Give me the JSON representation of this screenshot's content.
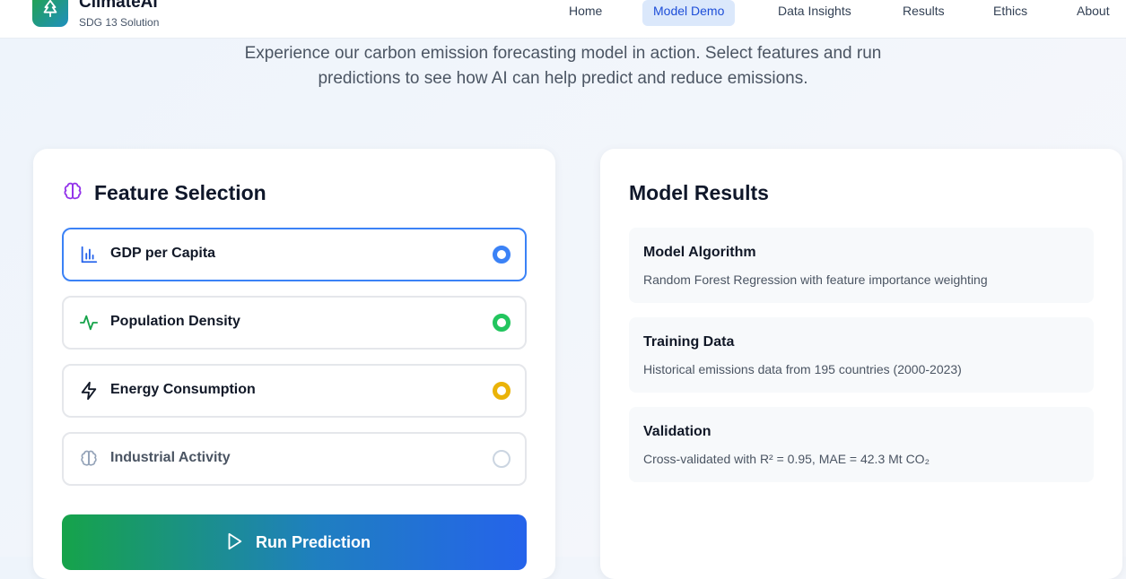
{
  "brand": {
    "name": "ClimateAI",
    "subtitle": "SDG 13 Solution"
  },
  "nav": {
    "items": [
      {
        "label": "Home"
      },
      {
        "label": "Model Demo",
        "active": true
      },
      {
        "label": "Data Insights"
      },
      {
        "label": "Results"
      },
      {
        "label": "Ethics"
      },
      {
        "label": "About"
      }
    ]
  },
  "hero": {
    "line1": "Experience our carbon emission forecasting model in action. Select features and run",
    "line2": "predictions to see how AI can help predict and reduce emissions."
  },
  "feature_selection": {
    "title": "Feature Selection",
    "title_icon": "brain-icon",
    "features": [
      {
        "label": "GDP per Capita",
        "icon": "bar-chart-icon",
        "selected": true,
        "color": "#3b82f6"
      },
      {
        "label": "Population Density",
        "icon": "activity-icon",
        "selected": true,
        "color": "#22c55e"
      },
      {
        "label": "Energy Consumption",
        "icon": "lightning-icon",
        "selected": true,
        "color": "#eab308"
      },
      {
        "label": "Industrial Activity",
        "icon": "brain-icon",
        "selected": false,
        "color": "#cbd5e1"
      }
    ],
    "run_button": "Run Prediction"
  },
  "model_results": {
    "title": "Model Results",
    "items": [
      {
        "title": "Model Algorithm",
        "desc": "Random Forest Regression with feature importance weighting"
      },
      {
        "title": "Training Data",
        "desc": "Historical emissions data from 195 countries (2000-2023)"
      },
      {
        "title": "Validation",
        "desc": "Cross-validated with R² = 0.95, MAE = 42.3 Mt CO₂"
      }
    ]
  },
  "colors": {
    "accent": "#1d4ed8",
    "nav_active_bg": "#dbe8fb",
    "brand_green": "#22a447"
  }
}
